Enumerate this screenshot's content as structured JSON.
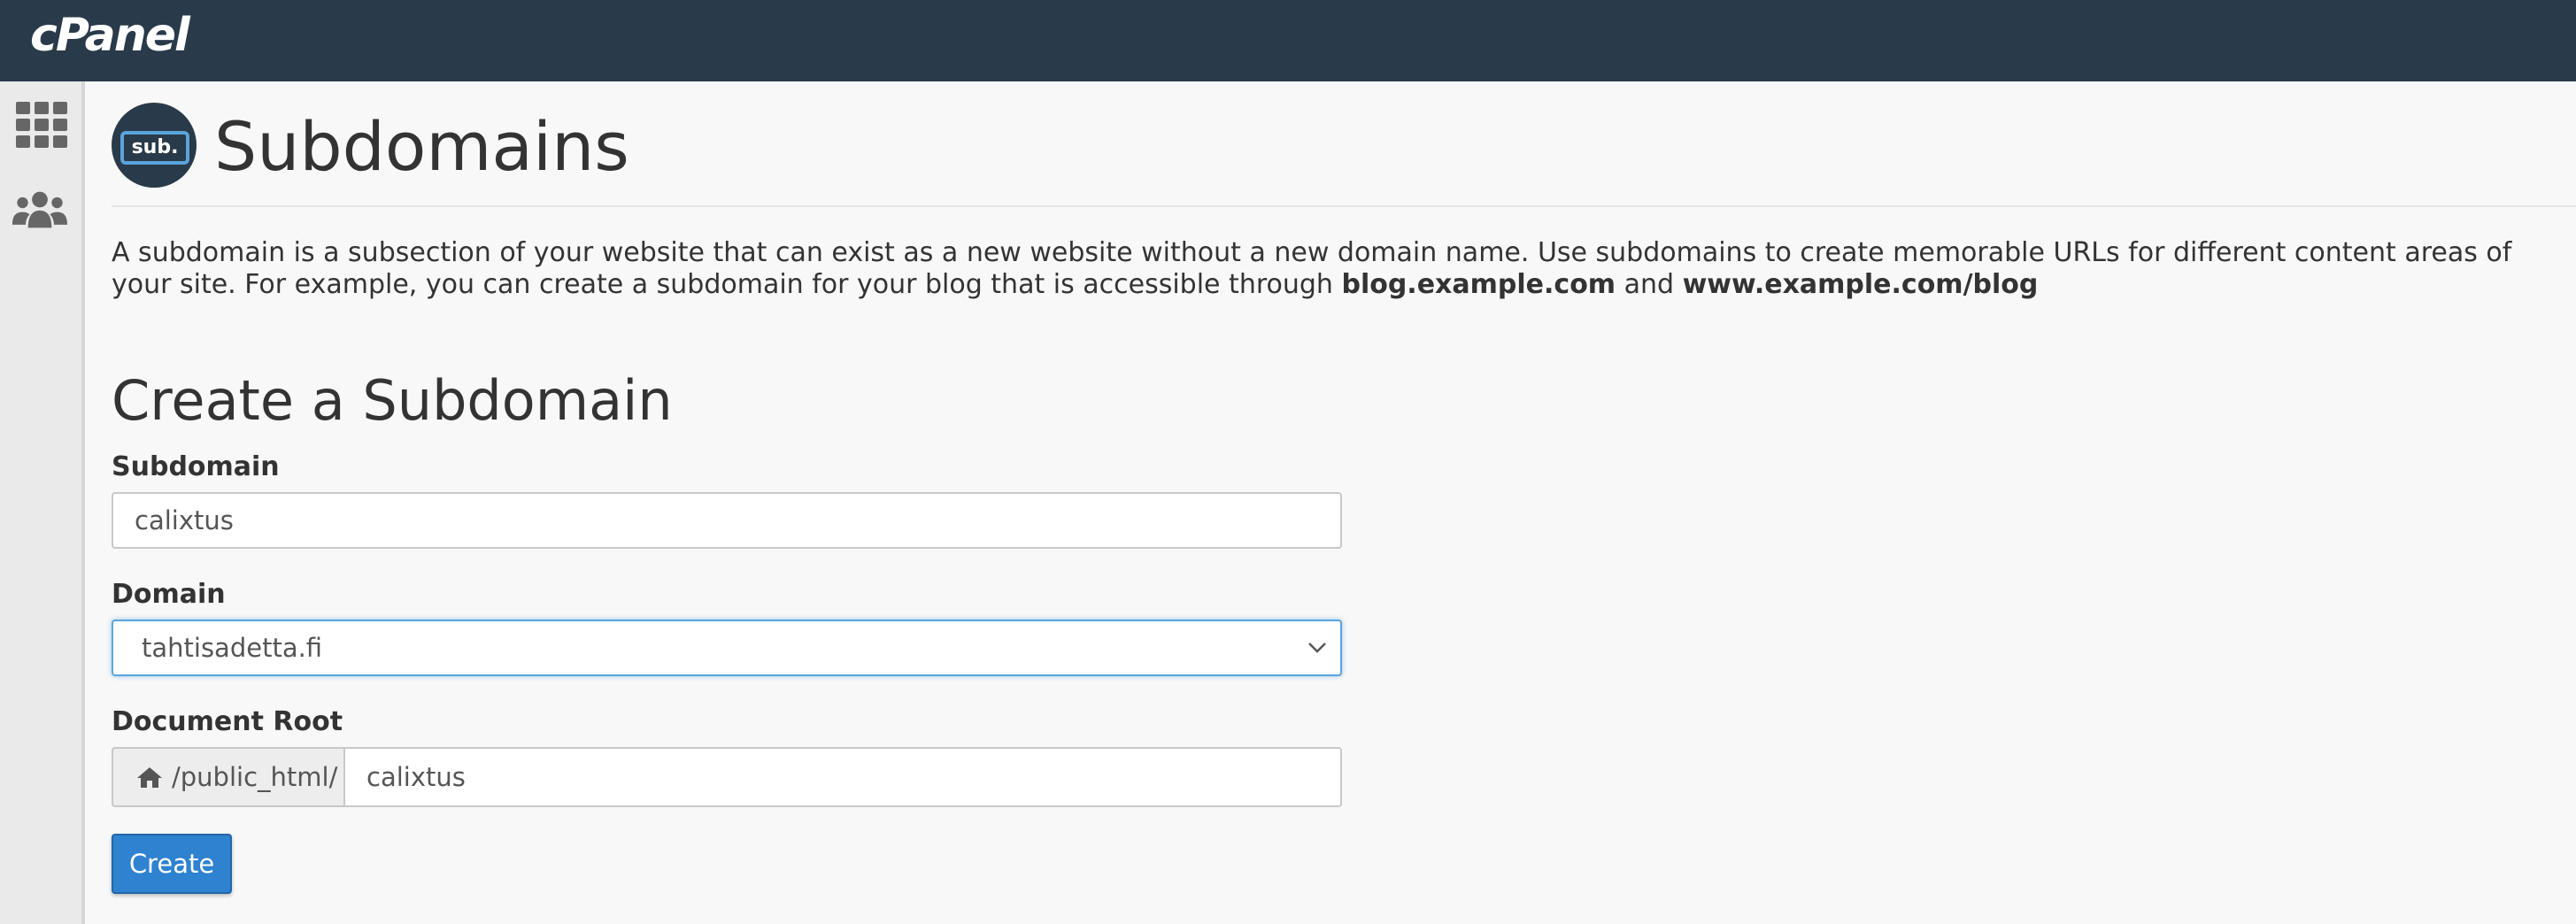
{
  "app": {
    "logo_text": "cPanel",
    "brand_color": "#293a4a",
    "accent_color": "#2e82d0"
  },
  "sidebar": {
    "items": [
      {
        "icon": "grid-icon"
      },
      {
        "icon": "users-icon"
      }
    ]
  },
  "header": {
    "badge_text": "sub.",
    "title": "Subdomains"
  },
  "description": {
    "text": "A subdomain is a subsection of your website that can exist as a new website without a new domain name. Use subdomains to create memorable URLs for different content areas of your site. For example, you can create a subdomain for your blog that is accessible through ",
    "example1": "blog.example.com",
    "connector": " and ",
    "example2": "www.example.com/blog"
  },
  "form": {
    "title": "Create a Subdomain",
    "subdomain_label": "Subdomain",
    "subdomain_value": "calixtus",
    "domain_label": "Domain",
    "domain_selected": "tahtisadetta.fi",
    "docroot_label": "Document Root",
    "docroot_prefix": "/public_html/",
    "docroot_value": "calixtus",
    "create_label": "Create"
  }
}
